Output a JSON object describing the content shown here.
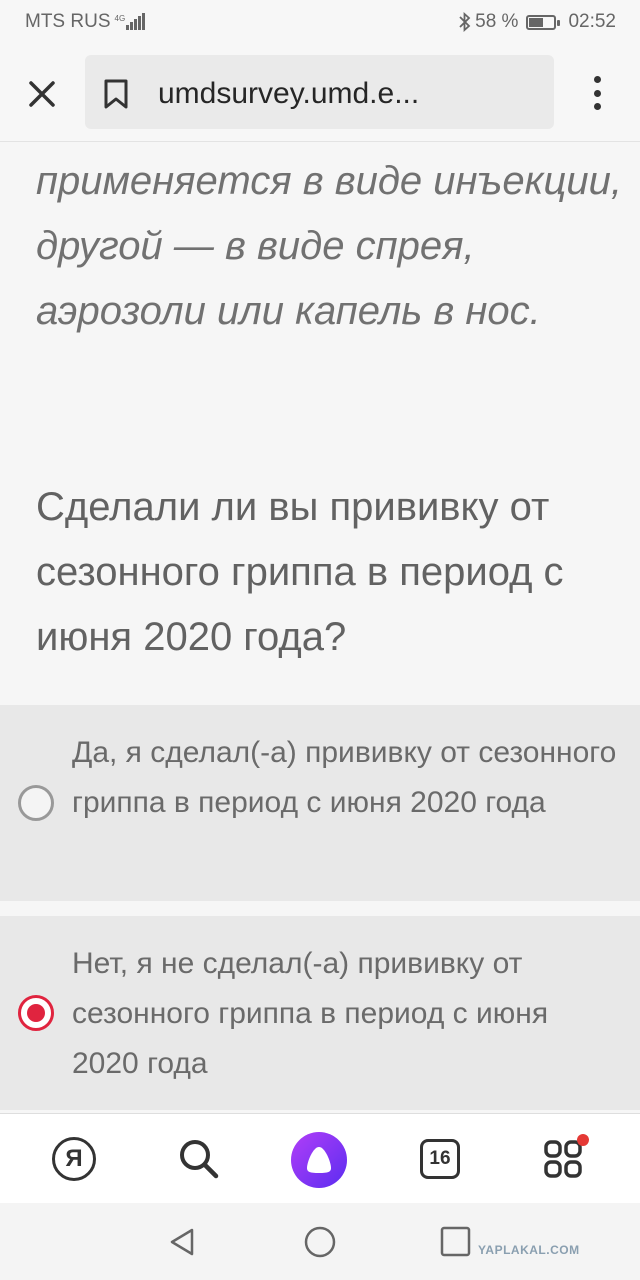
{
  "status_bar": {
    "carrier": "MTS RUS",
    "network": "4G",
    "battery_percent": "58 %",
    "battery_level": 0.58,
    "time": "02:52"
  },
  "browser": {
    "url": "umdsurvey.umd.e..."
  },
  "survey": {
    "description": "применяется в виде инъекции, другой — в виде спрея, аэрозоли или капель в нос.",
    "question": "Сделали ли вы прививку от сезонного гриппа в период с июня 2020 года?",
    "options": [
      {
        "label": "Да, я сделал(-а) прививку от сезонного гриппа в период с июня 2020 года",
        "selected": false
      },
      {
        "label": "Нет, я не сделал(-а) прививку от сезонного гриппа в период с июня 2020 года",
        "selected": true
      }
    ]
  },
  "bottom_nav": {
    "ya_label": "Я",
    "tabs_count": "16"
  },
  "watermark": "YAPLAKAL.COM",
  "colors": {
    "accent": "#e0243f",
    "alice_gradient_start": "#8a3cf7",
    "alice_gradient_end": "#5b2df0",
    "notification_dot": "#e53935"
  },
  "icons": [
    "close-icon",
    "bookmark-icon",
    "more-vert-icon",
    "yandex-icon",
    "search-icon",
    "alice-icon",
    "tabs-icon",
    "services-icon",
    "back-icon",
    "home-icon",
    "recent-apps-icon",
    "bluetooth-icon",
    "battery-icon",
    "signal-icon"
  ]
}
